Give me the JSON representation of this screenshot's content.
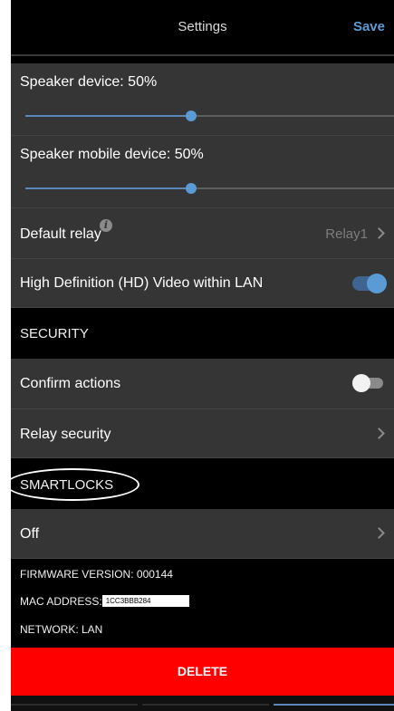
{
  "header": {
    "title": "Settings",
    "save_label": "Save"
  },
  "speaker_device": {
    "label": "Speaker device: 50%",
    "value_percent": 50
  },
  "speaker_mobile": {
    "label": "Speaker mobile device: 50%",
    "value_percent": 50
  },
  "default_relay": {
    "label": "Default relay",
    "info_icon": "info-icon",
    "value": "Relay1"
  },
  "hd_video": {
    "label": "High Definition (HD) Video within LAN",
    "enabled": true
  },
  "security_section": {
    "title": "SECURITY"
  },
  "confirm_actions": {
    "label": "Confirm actions",
    "enabled": false
  },
  "relay_security": {
    "label": "Relay security"
  },
  "smartlocks_section": {
    "title": "SMARTLOCKS"
  },
  "smartlocks_value": {
    "label": "Off"
  },
  "device_info": {
    "firmware": "FIRMWARE VERSION: 000144",
    "mac_label": "MAC ADDRESS:",
    "mac_value": "1CC3BBB284",
    "network": "NETWORK: LAN"
  },
  "delete_label": "DELETE",
  "colors": {
    "accent": "#5b9bd5",
    "delete": "#ff0000",
    "row_bg": "#353535",
    "section_bg": "#000000"
  }
}
